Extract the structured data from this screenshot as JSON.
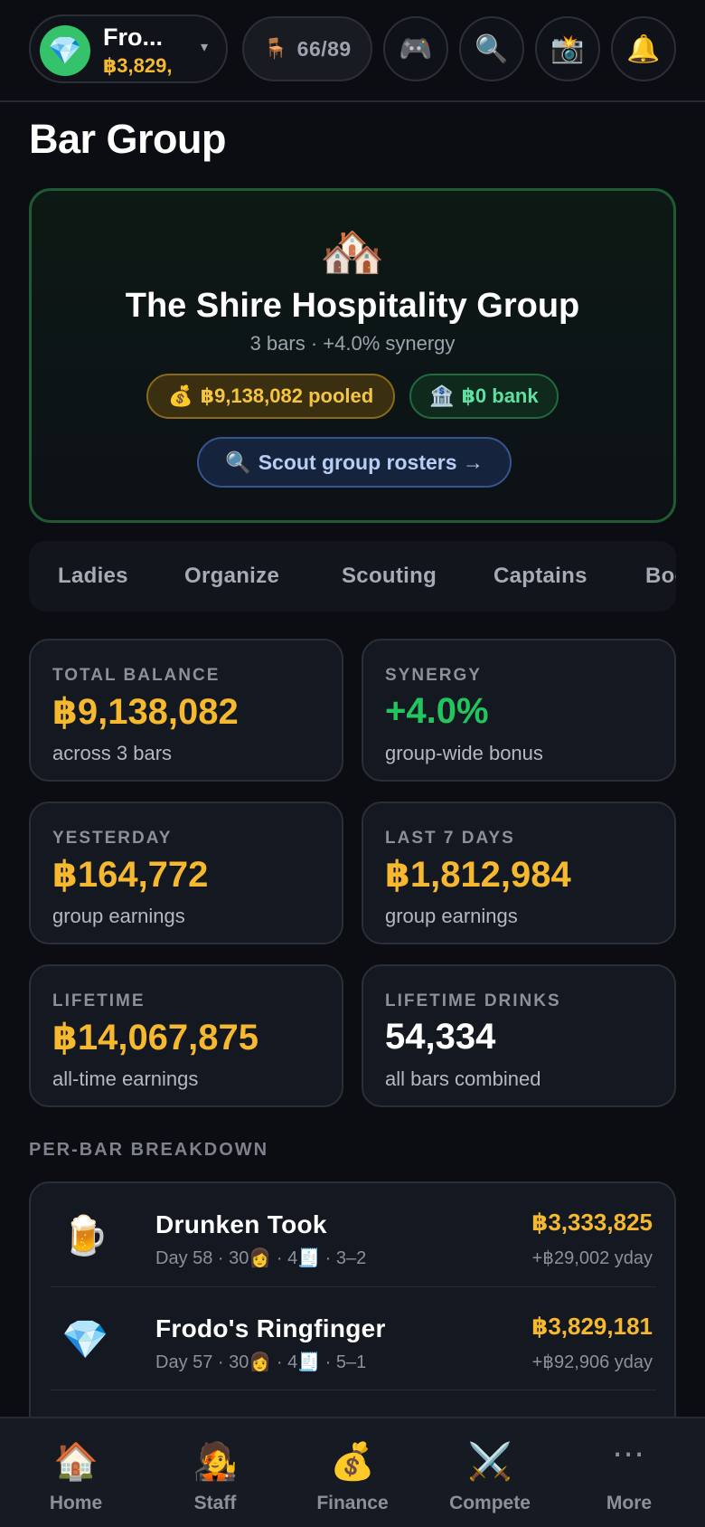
{
  "topbar": {
    "profile": {
      "avatar_icon": "💎",
      "name": "Fro...",
      "balance": "฿3,829,",
      "caret": "▾"
    },
    "seats": {
      "icon": "🪑",
      "text": "66/89"
    },
    "buttons": [
      {
        "icon": "🎮",
        "name": "gamepad-icon"
      },
      {
        "icon": "🔍",
        "name": "search-icon"
      },
      {
        "icon": "📸",
        "name": "camera-icon"
      },
      {
        "icon": "🔔",
        "name": "bell-icon"
      }
    ]
  },
  "page": {
    "title": "Bar Group"
  },
  "hero": {
    "emoji": "🏘️",
    "name": "The Shire Hospitality Group",
    "subtitle": "3 bars · +4.0% synergy",
    "pooled": {
      "icon": "💰",
      "text": "฿9,138,082 pooled"
    },
    "bank": {
      "icon": "🏦",
      "text": "฿0 bank"
    },
    "scout": {
      "icon": "🔍",
      "text": "Scout group rosters →"
    }
  },
  "tabs": [
    "Ladies",
    "Organize",
    "Scouting",
    "Captains",
    "Boosts"
  ],
  "stats": [
    {
      "label": "TOTAL BALANCE",
      "value": "฿9,138,082",
      "sub": "across 3 bars",
      "color": "#f5b82e"
    },
    {
      "label": "SYNERGY",
      "value": "+4.0%",
      "sub": "group-wide bonus",
      "color": "#22c55e"
    },
    {
      "label": "YESTERDAY",
      "value": "฿164,772",
      "sub": "group earnings",
      "color": "#f5b82e"
    },
    {
      "label": "LAST 7 DAYS",
      "value": "฿1,812,984",
      "sub": "group earnings",
      "color": "#f5b82e"
    },
    {
      "label": "LIFETIME",
      "value": "฿14,067,875",
      "sub": "all-time earnings",
      "color": "#f5b82e"
    },
    {
      "label": "LIFETIME DRINKS",
      "value": "54,334",
      "sub": "all bars combined",
      "color": "#ffffff"
    }
  ],
  "breakdown": {
    "label": "PER-BAR BREAKDOWN",
    "bars": [
      {
        "emoji": "🍺",
        "name": "Drunken Took",
        "meta": "Day 58 · 30👩 · 4🧾 · 3–2",
        "total": "฿3,333,825",
        "yday": "+฿29,002 yday"
      },
      {
        "emoji": "💎",
        "name": "Frodo's Ringfinger",
        "meta": "Day 57 · 30👩 · 4🧾 · 5–1",
        "total": "฿3,829,181",
        "yday": "+฿92,906 yday"
      }
    ]
  },
  "nav": [
    {
      "icon": "🏠",
      "label": "Home"
    },
    {
      "icon": "🧑‍🎤",
      "label": "Staff"
    },
    {
      "icon": "💰",
      "label": "Finance"
    },
    {
      "icon": "⚔️",
      "label": "Compete"
    },
    {
      "icon": "⋯",
      "label": "More"
    }
  ]
}
